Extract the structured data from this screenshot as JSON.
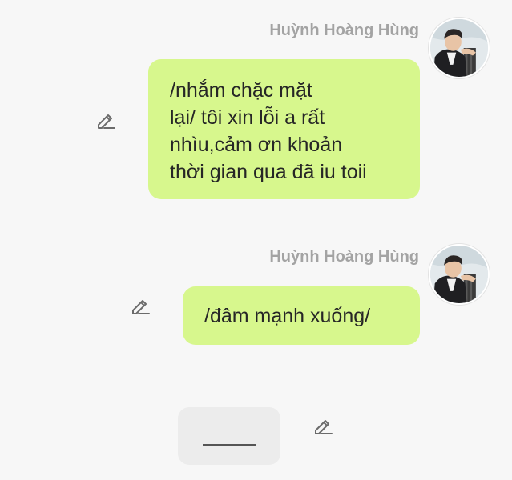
{
  "messages": [
    {
      "sender": "Huỳnh Hoàng Hùng",
      "text": "/nhắm chặc mặt\nlại/ tôi xin lỗi a rất\nnhìu,cảm ơn khoản\nthời gian qua đã iu toii",
      "avatar_icon": "profile-photo",
      "edit_icon": "pencil-icon"
    },
    {
      "sender": "Huỳnh Hoàng Hùng",
      "text": "/đâm mạnh xuống/",
      "avatar_icon": "profile-photo",
      "edit_icon": "pencil-icon"
    }
  ],
  "draft": {
    "edit_icon": "pencil-icon"
  },
  "colors": {
    "background": "#f7f7f7",
    "bubble": "#d7f78d",
    "sender_name": "#a3a3a3",
    "message_text": "#262626",
    "draft_bubble": "#ececec",
    "edit_icon": "#6b6b6b"
  }
}
